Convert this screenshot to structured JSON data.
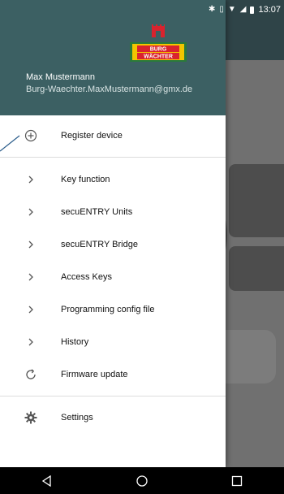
{
  "status_bar": {
    "time": "13:07"
  },
  "drawer": {
    "brand": {
      "line1": "BURG",
      "line2": "WÄCHTER"
    },
    "user_name": "Max Mustermann",
    "user_email": "Burg-Waechter.MaxMustermann@gmx.de"
  },
  "menu": {
    "register": {
      "icon": "add-circle-icon",
      "label": "Register device"
    },
    "items": [
      {
        "icon": "chevron-right-icon",
        "label": "Key function"
      },
      {
        "icon": "chevron-right-icon",
        "label": "secuENTRY Units"
      },
      {
        "icon": "chevron-right-icon",
        "label": "secuENTRY Bridge"
      },
      {
        "icon": "chevron-right-icon",
        "label": "Access Keys"
      },
      {
        "icon": "chevron-right-icon",
        "label": "Programming config file"
      },
      {
        "icon": "chevron-right-icon",
        "label": "History"
      },
      {
        "icon": "refresh-icon",
        "label": "Firmware update"
      }
    ],
    "settings": {
      "icon": "gear-icon",
      "label": "Settings"
    }
  },
  "colors": {
    "header": "#3c6063",
    "topbar": "#2f4448",
    "logo_red": "#d9232e",
    "logo_yellow": "#f2c500",
    "pointer": "#2a5c8a"
  }
}
